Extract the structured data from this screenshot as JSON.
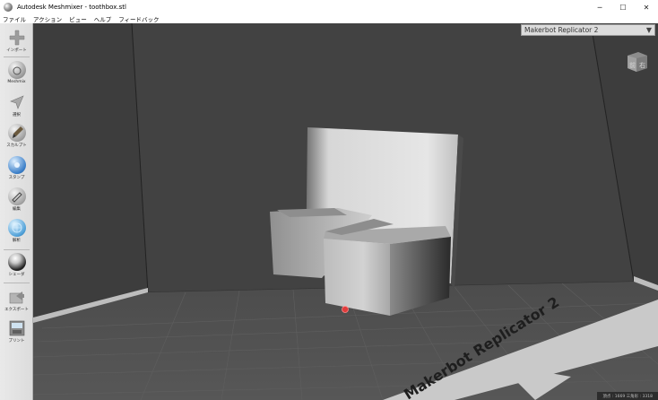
{
  "window": {
    "title": "Autodesk Meshmixer - toothbox.stl",
    "minimize": "─",
    "maximize": "☐",
    "close": "✕"
  },
  "menu": [
    "ファイル",
    "アクション",
    "ビュー",
    "ヘルプ",
    "フィードバック"
  ],
  "toolbar": [
    {
      "label": "インポート",
      "icon": "plus-icon"
    },
    {
      "label": "Meshmix",
      "icon": "meshmix-icon"
    },
    {
      "label": "選択",
      "icon": "select-arrow-icon"
    },
    {
      "label": "スカルプト",
      "icon": "sculpt-brush-icon"
    },
    {
      "label": "スタンプ",
      "icon": "stamp-icon"
    },
    {
      "label": "編集",
      "icon": "edit-icon"
    },
    {
      "label": "解析",
      "icon": "analysis-icon"
    },
    {
      "label": "シェーダ",
      "icon": "shader-icon"
    },
    {
      "label": "エクスポート",
      "icon": "export-icon"
    },
    {
      "label": "プリント",
      "icon": "print-icon"
    }
  ],
  "printer_select": {
    "value": "Makerbot Replicator 2",
    "arrow": "▼"
  },
  "viewcube": {
    "front": "前",
    "right": "右"
  },
  "build_plate_label": "Makerbot Replicator 2",
  "status": "頂点 : 1669 三角形 : 3318"
}
